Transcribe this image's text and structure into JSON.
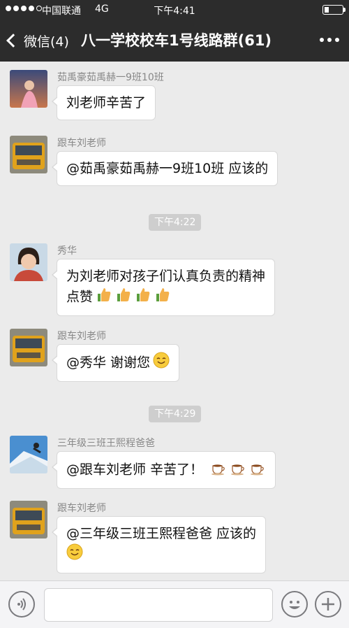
{
  "status_bar": {
    "carrier": "中国联通",
    "network": "4G",
    "time": "下午4:41",
    "battery_level": 0.25
  },
  "nav": {
    "back_label": "微信(4)",
    "title": "八一学校校车1号线路群(61)"
  },
  "messages": [
    {
      "sender": "茹禹豪茹禹赫一9班10班",
      "lines": [
        "刘老师辛苦了"
      ],
      "emoji": []
    },
    {
      "sender": "跟车刘老师",
      "lines": [
        "@茹禹豪茹禹赫一9班10班 应该的"
      ],
      "emoji": []
    },
    {
      "timestamp": "下午4:22"
    },
    {
      "sender": "秀华",
      "lines": [
        "为刘老师对孩子们认真负责的精神",
        "点赞"
      ],
      "emoji": [
        "thumbs-up",
        "thumbs-up",
        "thumbs-up",
        "thumbs-up"
      ]
    },
    {
      "sender": "跟车刘老师",
      "lines": [
        "@秀华 谢谢您"
      ],
      "emoji": [
        "smile"
      ]
    },
    {
      "timestamp": "下午4:29"
    },
    {
      "sender": "三年级三班王熙程爸爸",
      "lines": [
        "@跟车刘老师 辛苦了！"
      ],
      "emoji": [
        "coffee",
        "coffee",
        "coffee"
      ]
    },
    {
      "sender": "跟车刘老师",
      "lines": [
        "@三年级三班王熙程爸爸 应该的"
      ],
      "emoji": [
        "smile"
      ]
    }
  ],
  "icons": {
    "voice": "voice-icon",
    "emoji": "emoji-icon",
    "add": "add-icon"
  },
  "colors": {
    "nav_bg": "#2c2c2c",
    "chat_bg": "#ebebeb",
    "bubble_bg": "#ffffff",
    "timestamp_bg": "#cecece"
  }
}
